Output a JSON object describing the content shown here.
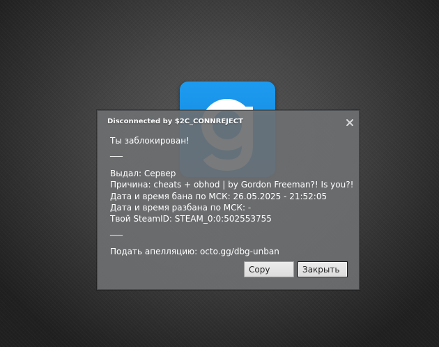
{
  "background": {
    "logo_letter": "g",
    "logo_color": "#1d9bf0"
  },
  "dialog": {
    "title": "Disconnected by $2C_CONNREJECT",
    "close_icon": "close-icon",
    "lines": [
      "Ты заблокирован!",
      "___",
      "Выдал: Сервер",
      "Причина: cheats + obhod | by Gordon Freeman?! Is you?!",
      "Дата и время бана по МСК: 26.05.2025 - 21:52:05",
      "Дата и время разбана по МСК: -",
      "Твой SteamID: STEAM_0:0:502553755",
      "___",
      "Подать апелляцию: octo.gg/dbg-unban"
    ],
    "buttons": {
      "copy_label": "Copy",
      "close_label": "Закрыть"
    }
  }
}
